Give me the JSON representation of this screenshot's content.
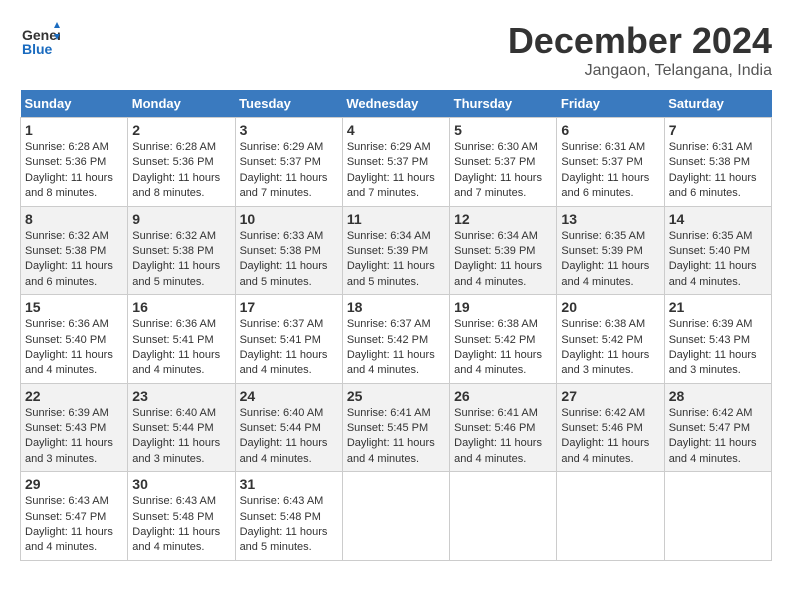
{
  "header": {
    "logo_line1": "General",
    "logo_line2": "Blue",
    "month_title": "December 2024",
    "location": "Jangaon, Telangana, India"
  },
  "days_of_week": [
    "Sunday",
    "Monday",
    "Tuesday",
    "Wednesday",
    "Thursday",
    "Friday",
    "Saturday"
  ],
  "weeks": [
    [
      {
        "day": "1",
        "sunrise": "6:28 AM",
        "sunset": "5:36 PM",
        "daylight": "11 hours and 8 minutes."
      },
      {
        "day": "2",
        "sunrise": "6:28 AM",
        "sunset": "5:36 PM",
        "daylight": "11 hours and 8 minutes."
      },
      {
        "day": "3",
        "sunrise": "6:29 AM",
        "sunset": "5:37 PM",
        "daylight": "11 hours and 7 minutes."
      },
      {
        "day": "4",
        "sunrise": "6:29 AM",
        "sunset": "5:37 PM",
        "daylight": "11 hours and 7 minutes."
      },
      {
        "day": "5",
        "sunrise": "6:30 AM",
        "sunset": "5:37 PM",
        "daylight": "11 hours and 7 minutes."
      },
      {
        "day": "6",
        "sunrise": "6:31 AM",
        "sunset": "5:37 PM",
        "daylight": "11 hours and 6 minutes."
      },
      {
        "day": "7",
        "sunrise": "6:31 AM",
        "sunset": "5:38 PM",
        "daylight": "11 hours and 6 minutes."
      }
    ],
    [
      {
        "day": "8",
        "sunrise": "6:32 AM",
        "sunset": "5:38 PM",
        "daylight": "11 hours and 6 minutes."
      },
      {
        "day": "9",
        "sunrise": "6:32 AM",
        "sunset": "5:38 PM",
        "daylight": "11 hours and 5 minutes."
      },
      {
        "day": "10",
        "sunrise": "6:33 AM",
        "sunset": "5:38 PM",
        "daylight": "11 hours and 5 minutes."
      },
      {
        "day": "11",
        "sunrise": "6:34 AM",
        "sunset": "5:39 PM",
        "daylight": "11 hours and 5 minutes."
      },
      {
        "day": "12",
        "sunrise": "6:34 AM",
        "sunset": "5:39 PM",
        "daylight": "11 hours and 4 minutes."
      },
      {
        "day": "13",
        "sunrise": "6:35 AM",
        "sunset": "5:39 PM",
        "daylight": "11 hours and 4 minutes."
      },
      {
        "day": "14",
        "sunrise": "6:35 AM",
        "sunset": "5:40 PM",
        "daylight": "11 hours and 4 minutes."
      }
    ],
    [
      {
        "day": "15",
        "sunrise": "6:36 AM",
        "sunset": "5:40 PM",
        "daylight": "11 hours and 4 minutes."
      },
      {
        "day": "16",
        "sunrise": "6:36 AM",
        "sunset": "5:41 PM",
        "daylight": "11 hours and 4 minutes."
      },
      {
        "day": "17",
        "sunrise": "6:37 AM",
        "sunset": "5:41 PM",
        "daylight": "11 hours and 4 minutes."
      },
      {
        "day": "18",
        "sunrise": "6:37 AM",
        "sunset": "5:42 PM",
        "daylight": "11 hours and 4 minutes."
      },
      {
        "day": "19",
        "sunrise": "6:38 AM",
        "sunset": "5:42 PM",
        "daylight": "11 hours and 4 minutes."
      },
      {
        "day": "20",
        "sunrise": "6:38 AM",
        "sunset": "5:42 PM",
        "daylight": "11 hours and 3 minutes."
      },
      {
        "day": "21",
        "sunrise": "6:39 AM",
        "sunset": "5:43 PM",
        "daylight": "11 hours and 3 minutes."
      }
    ],
    [
      {
        "day": "22",
        "sunrise": "6:39 AM",
        "sunset": "5:43 PM",
        "daylight": "11 hours and 3 minutes."
      },
      {
        "day": "23",
        "sunrise": "6:40 AM",
        "sunset": "5:44 PM",
        "daylight": "11 hours and 3 minutes."
      },
      {
        "day": "24",
        "sunrise": "6:40 AM",
        "sunset": "5:44 PM",
        "daylight": "11 hours and 4 minutes."
      },
      {
        "day": "25",
        "sunrise": "6:41 AM",
        "sunset": "5:45 PM",
        "daylight": "11 hours and 4 minutes."
      },
      {
        "day": "26",
        "sunrise": "6:41 AM",
        "sunset": "5:46 PM",
        "daylight": "11 hours and 4 minutes."
      },
      {
        "day": "27",
        "sunrise": "6:42 AM",
        "sunset": "5:46 PM",
        "daylight": "11 hours and 4 minutes."
      },
      {
        "day": "28",
        "sunrise": "6:42 AM",
        "sunset": "5:47 PM",
        "daylight": "11 hours and 4 minutes."
      }
    ],
    [
      {
        "day": "29",
        "sunrise": "6:43 AM",
        "sunset": "5:47 PM",
        "daylight": "11 hours and 4 minutes."
      },
      {
        "day": "30",
        "sunrise": "6:43 AM",
        "sunset": "5:48 PM",
        "daylight": "11 hours and 4 minutes."
      },
      {
        "day": "31",
        "sunrise": "6:43 AM",
        "sunset": "5:48 PM",
        "daylight": "11 hours and 5 minutes."
      },
      null,
      null,
      null,
      null
    ]
  ],
  "labels": {
    "sunrise": "Sunrise:",
    "sunset": "Sunset:",
    "daylight": "Daylight:"
  }
}
